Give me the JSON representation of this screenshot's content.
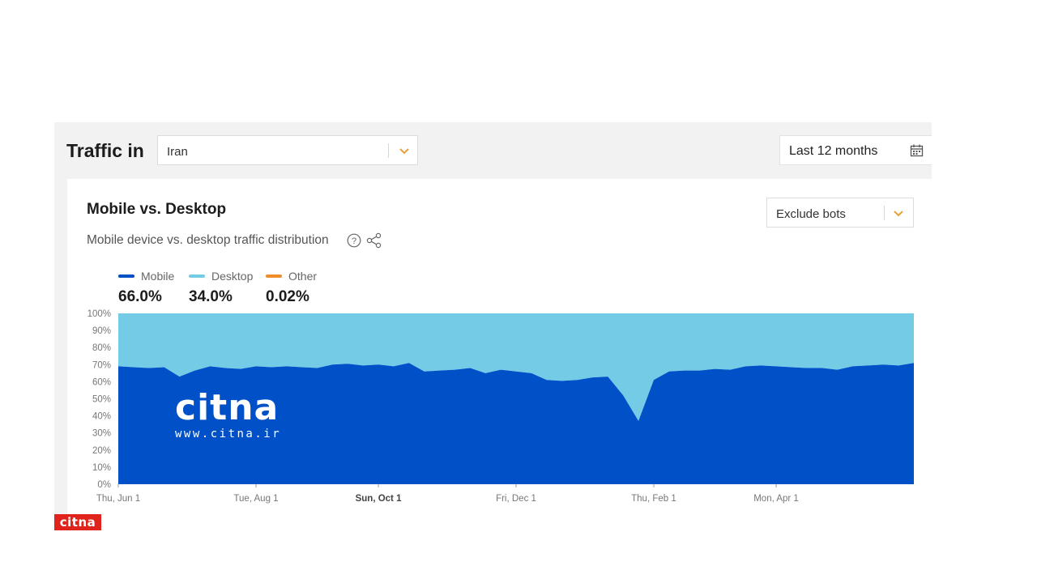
{
  "header": {
    "title": "Traffic in",
    "country": "Iran",
    "date_range": "Last 12 months"
  },
  "card": {
    "title": "Mobile vs. Desktop",
    "subtitle": "Mobile device vs. desktop traffic distribution",
    "bot_filter": "Exclude bots"
  },
  "icons": {
    "dropdown": "chevron-down-icon",
    "calendar": "calendar-icon",
    "help": "question-circle-icon",
    "share": "share-icon"
  },
  "colors": {
    "mobile": "#0050c8",
    "desktop": "#74cbe6",
    "other": "#f08c2a",
    "accent": "#e8a13a",
    "brand_red": "#e0241b"
  },
  "legend": [
    {
      "name": "Mobile",
      "value": "66.0%"
    },
    {
      "name": "Desktop",
      "value": "34.0%"
    },
    {
      "name": "Other",
      "value": "0.02%"
    }
  ],
  "watermark": {
    "logo": "citna",
    "url": "www.citna.ir",
    "corner_logo": "citna"
  },
  "chart_data": {
    "type": "area",
    "stacked": true,
    "y_ticks": [
      "100%",
      "90%",
      "80%",
      "70%",
      "60%",
      "50%",
      "40%",
      "30%",
      "20%",
      "10%",
      "0%"
    ],
    "ylim": [
      0,
      100
    ],
    "x_ticks": [
      {
        "label": "Thu, Jun 1",
        "index": 0,
        "bold": false
      },
      {
        "label": "Tue, Aug 1",
        "index": 9,
        "bold": false
      },
      {
        "label": "Sun, Oct 1",
        "index": 17,
        "bold": true
      },
      {
        "label": "Fri, Dec 1",
        "index": 26,
        "bold": false
      },
      {
        "label": "Thu, Feb 1",
        "index": 35,
        "bold": false
      },
      {
        "label": "Mon, Apr 1",
        "index": 43,
        "bold": false
      }
    ],
    "series": [
      {
        "name": "Mobile",
        "values": [
          69,
          68.5,
          68,
          68.5,
          63,
          66.5,
          69,
          68,
          67.5,
          69,
          68.5,
          69,
          68.5,
          68,
          70,
          70.5,
          69.5,
          70,
          69,
          71,
          66,
          66.5,
          67,
          68,
          65,
          67,
          66,
          65,
          61,
          60.5,
          61,
          62.5,
          63,
          52,
          37,
          61,
          66,
          66.5,
          66.5,
          67.5,
          67,
          69,
          69.5,
          69,
          68.5,
          68,
          68,
          67,
          69,
          69.5,
          70,
          69.5,
          71
        ]
      },
      {
        "name": "Desktop",
        "values": [
          31,
          31.5,
          32,
          31.5,
          37,
          33.5,
          31,
          32,
          32.5,
          31,
          31.5,
          31,
          31.5,
          32,
          30,
          29.5,
          30.5,
          30,
          31,
          29,
          34,
          33.5,
          33,
          32,
          35,
          33,
          34,
          35,
          39,
          39.5,
          39,
          37.5,
          37,
          48,
          63,
          39,
          34,
          33.5,
          33.5,
          32.5,
          33,
          31,
          30.5,
          31,
          31.5,
          32,
          32,
          33,
          31,
          30.5,
          30,
          30.5,
          29
        ]
      }
    ]
  }
}
